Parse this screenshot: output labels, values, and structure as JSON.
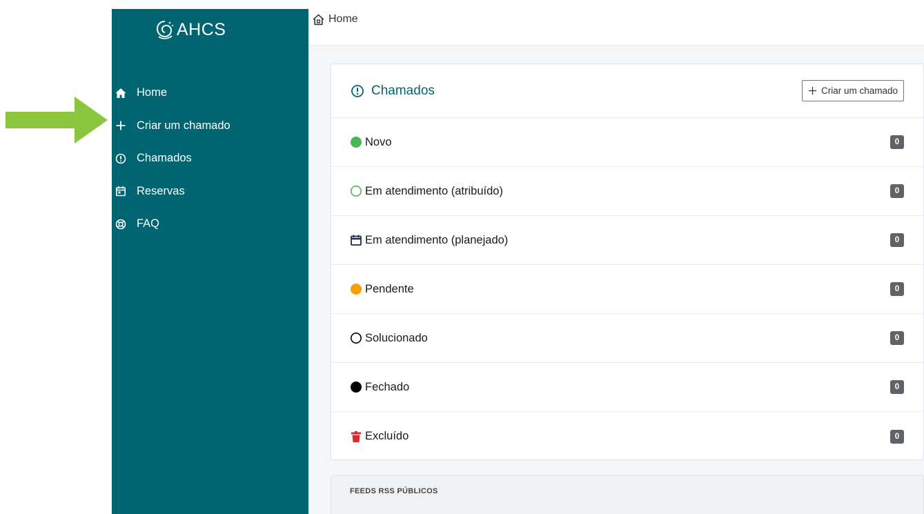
{
  "annotation": {
    "color": "#8cc63f"
  },
  "brand": {
    "name": "AHCS",
    "sidebar_color": "#006570"
  },
  "sidebar": {
    "items": [
      {
        "label": "Home",
        "icon": "home-icon"
      },
      {
        "label": "Criar um chamado",
        "icon": "plus-icon"
      },
      {
        "label": "Chamados",
        "icon": "alert-circle-icon"
      },
      {
        "label": "Reservas",
        "icon": "calendar-icon"
      },
      {
        "label": "FAQ",
        "icon": "lifebuoy-icon"
      }
    ]
  },
  "breadcrumb": {
    "label": "Home",
    "icon": "home-outline-icon"
  },
  "tickets_card": {
    "title": "Chamados",
    "title_icon": "alert-circle-icon",
    "create_button": "Criar um chamado",
    "rows": [
      {
        "label": "Novo",
        "count": "0",
        "icon": "filled-circle-icon",
        "color": "#49b654"
      },
      {
        "label": "Em atendimento (atribuído)",
        "count": "0",
        "icon": "outline-circle-icon",
        "color": "#49b654"
      },
      {
        "label": "Em atendimento (planejado)",
        "count": "0",
        "icon": "calendar-icon",
        "color": "#1a2a4a"
      },
      {
        "label": "Pendente",
        "count": "0",
        "icon": "filled-circle-icon",
        "color": "#f5a000"
      },
      {
        "label": "Solucionado",
        "count": "0",
        "icon": "outline-circle-icon",
        "color": "#000000"
      },
      {
        "label": "Fechado",
        "count": "0",
        "icon": "filled-circle-icon",
        "color": "#000000"
      },
      {
        "label": "Excluído",
        "count": "0",
        "icon": "trash-icon",
        "color": "#d92b2b"
      }
    ]
  },
  "feeds": {
    "title": "FEEDS RSS PÚBLICOS"
  }
}
